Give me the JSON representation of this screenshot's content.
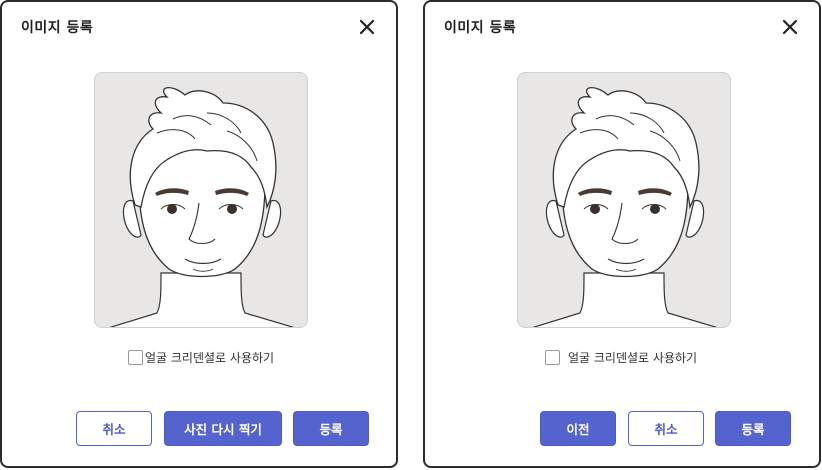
{
  "dialogs": [
    {
      "title": "이미지 등록",
      "credential_label": "얼굴 크리덴셜로 사용하기",
      "credential_checked": false,
      "buttons": [
        {
          "label": "취소",
          "style": "outline"
        },
        {
          "label": "사진 다시 찍기",
          "style": "filled"
        },
        {
          "label": "등록",
          "style": "filled"
        }
      ]
    },
    {
      "title": "이미지 등록",
      "credential_label": "얼굴 크리덴셜로 사용하기",
      "credential_checked": false,
      "buttons": [
        {
          "label": "이전",
          "style": "filled"
        },
        {
          "label": "취소",
          "style": "outline"
        },
        {
          "label": "등록",
          "style": "filled"
        }
      ]
    }
  ],
  "colors": {
    "accent": "#5563cf",
    "photo_background": "#e8e7e5",
    "border": "#2b2b2b"
  },
  "icons": {
    "close": "close-icon",
    "photo": "face-illustration"
  }
}
